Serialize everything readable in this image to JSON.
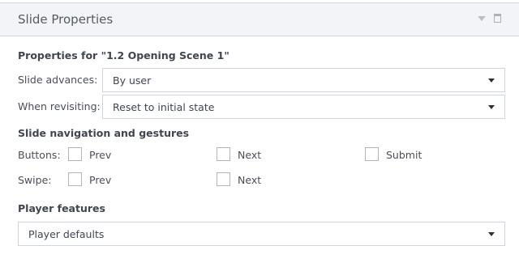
{
  "panel": {
    "title": "Slide Properties"
  },
  "properties_heading": "Properties for \"1.2 Opening Scene 1\"",
  "slide_advances": {
    "label": "Slide advances:",
    "value": "By user"
  },
  "when_revisiting": {
    "label": "When revisiting:",
    "value": "Reset to initial state"
  },
  "navigation": {
    "heading": "Slide navigation and gestures",
    "buttons": {
      "label": "Buttons:",
      "prev": "Prev",
      "next": "Next",
      "submit": "Submit"
    },
    "swipe": {
      "label": "Swipe:",
      "prev": "Prev",
      "next": "Next"
    }
  },
  "player": {
    "heading": "Player features",
    "value": "Player defaults"
  },
  "icons": {
    "collapse": "chevron-down-icon",
    "restore": "window-restore-icon"
  }
}
